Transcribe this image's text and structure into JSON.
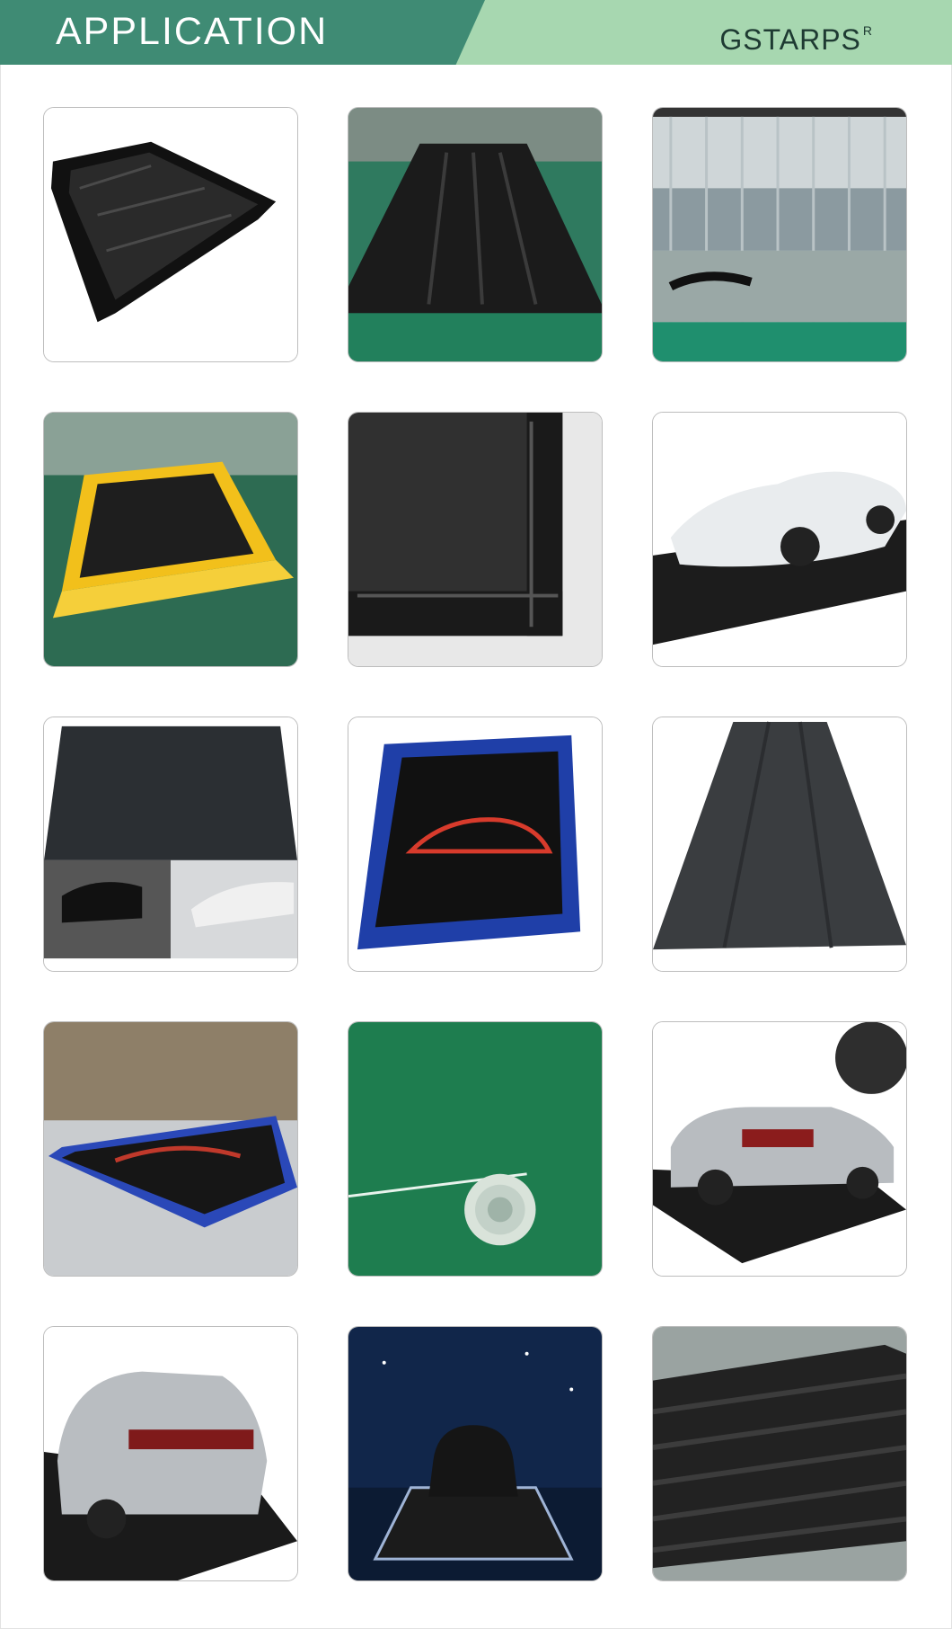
{
  "header": {
    "title": "APPLICATION",
    "brand": "GSTARPS",
    "brand_mark": "R",
    "colors": {
      "dark": "#3f8b74",
      "light": "#a7d7b0"
    }
  },
  "gallery": [
    {
      "subject": "black inflatable wash containment mat"
    },
    {
      "subject": "black containment mat on green floor"
    },
    {
      "subject": "clear curtain wash bay with mat"
    },
    {
      "subject": "yellow inflatable containment mat"
    },
    {
      "subject": "black mat edge close-up"
    },
    {
      "subject": "white sports car on wash mat"
    },
    {
      "subject": "black mat with cars"
    },
    {
      "subject": "blue inflatable mat with car logo"
    },
    {
      "subject": "black mat spread on floor"
    },
    {
      "subject": "blue mat in workshop"
    },
    {
      "subject": "green tarp roll"
    },
    {
      "subject": "silver sedan on black mat"
    },
    {
      "subject": "silver sedan rear on black mat"
    },
    {
      "subject": "black car on lit showroom mat"
    },
    {
      "subject": "stacked black mats"
    }
  ]
}
